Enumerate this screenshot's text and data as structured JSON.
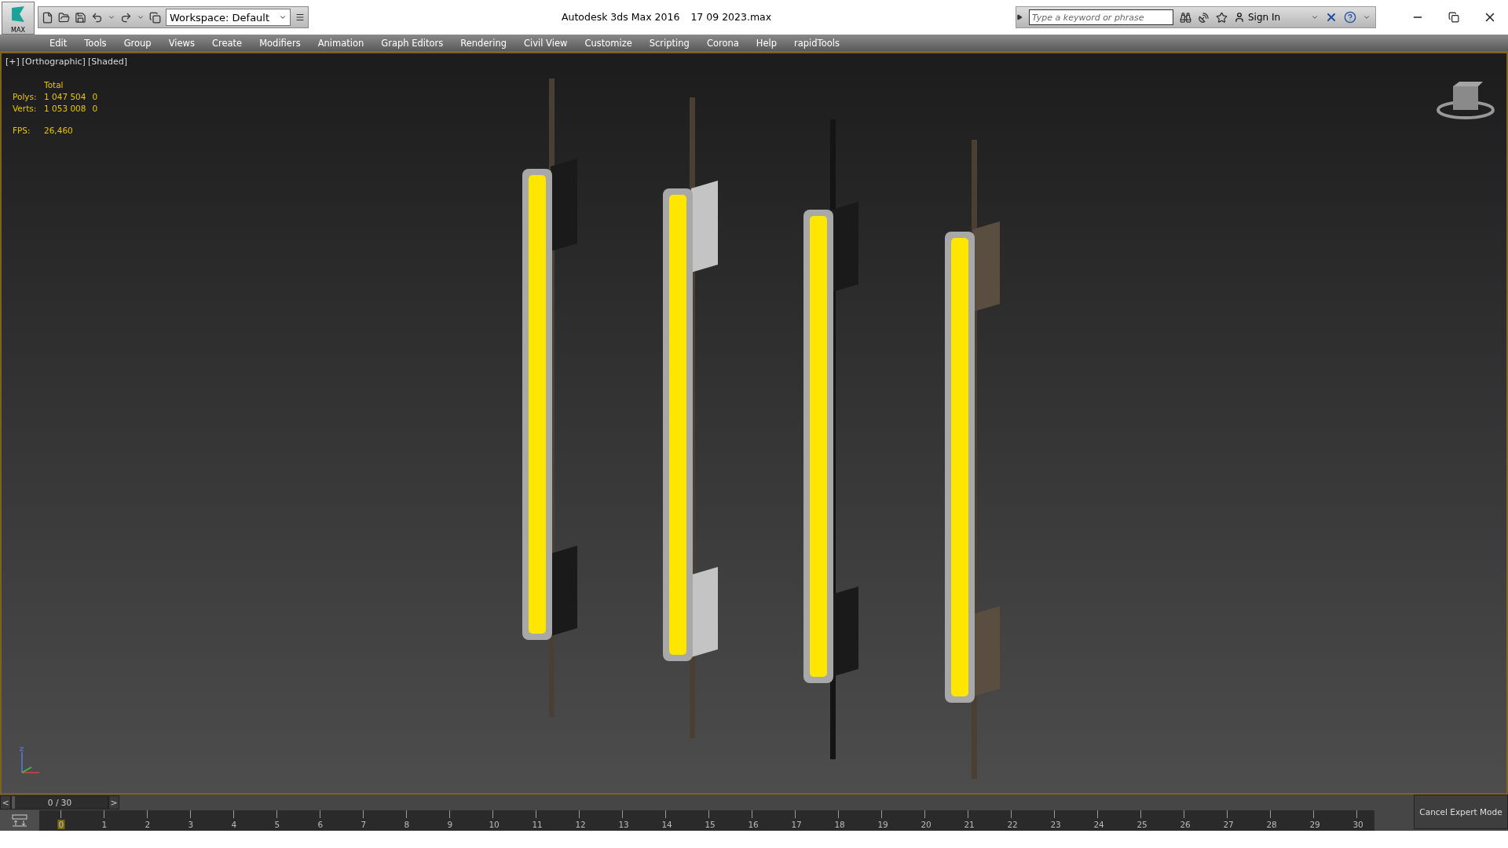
{
  "window": {
    "title": "Autodesk 3ds Max 2016",
    "file": "17 09 2023.max"
  },
  "app_button": {
    "label": "MAX"
  },
  "workspace": {
    "value": "Workspace: Default"
  },
  "search": {
    "placeholder": "Type a keyword or phrase"
  },
  "sign_in": {
    "label": "Sign In"
  },
  "menu": [
    "Edit",
    "Tools",
    "Group",
    "Views",
    "Create",
    "Modifiers",
    "Animation",
    "Graph Editors",
    "Rendering",
    "Civil View",
    "Customize",
    "Scripting",
    "Corona",
    "Help",
    "rapidTools"
  ],
  "viewport": {
    "labels": [
      "[+]",
      "[Orthographic]",
      "[Shaded]"
    ],
    "stats": {
      "header": "Total",
      "rows": [
        {
          "label": "Polys:",
          "total": "1 047 504",
          "selected": "0"
        },
        {
          "label": "Verts:",
          "total": "1 053 008",
          "selected": "0"
        }
      ],
      "fps_label": "FPS:",
      "fps": "26,460"
    }
  },
  "time_slider": {
    "prev": "<",
    "frame": "0 / 30",
    "next": ">",
    "level": 0
  },
  "ticks": [
    {
      "label": "0",
      "selected": true
    },
    {
      "label": "1",
      "selected": false
    },
    {
      "label": "2",
      "selected": false
    },
    {
      "label": "3",
      "selected": false
    },
    {
      "label": "4",
      "selected": false
    },
    {
      "label": "5",
      "selected": false
    },
    {
      "label": "6",
      "selected": false
    },
    {
      "label": "7",
      "selected": false
    },
    {
      "label": "8",
      "selected": false
    },
    {
      "label": "9",
      "selected": false
    },
    {
      "label": "10",
      "selected": false
    },
    {
      "label": "11",
      "selected": false
    },
    {
      "label": "12",
      "selected": false
    },
    {
      "label": "13",
      "selected": false
    },
    {
      "label": "14",
      "selected": false
    },
    {
      "label": "15",
      "selected": false
    },
    {
      "label": "16",
      "selected": false
    },
    {
      "label": "17",
      "selected": false
    },
    {
      "label": "18",
      "selected": false
    },
    {
      "label": "19",
      "selected": false
    },
    {
      "label": "20",
      "selected": false
    },
    {
      "label": "21",
      "selected": false
    },
    {
      "label": "22",
      "selected": false
    },
    {
      "label": "23",
      "selected": false
    },
    {
      "label": "24",
      "selected": false
    },
    {
      "label": "25",
      "selected": false
    },
    {
      "label": "26",
      "selected": false
    },
    {
      "label": "27",
      "selected": false
    },
    {
      "label": "28",
      "selected": false
    },
    {
      "label": "29",
      "selected": false
    },
    {
      "label": "30",
      "selected": false
    }
  ],
  "expert_mode": {
    "label": "Cancel Expert Mode"
  }
}
